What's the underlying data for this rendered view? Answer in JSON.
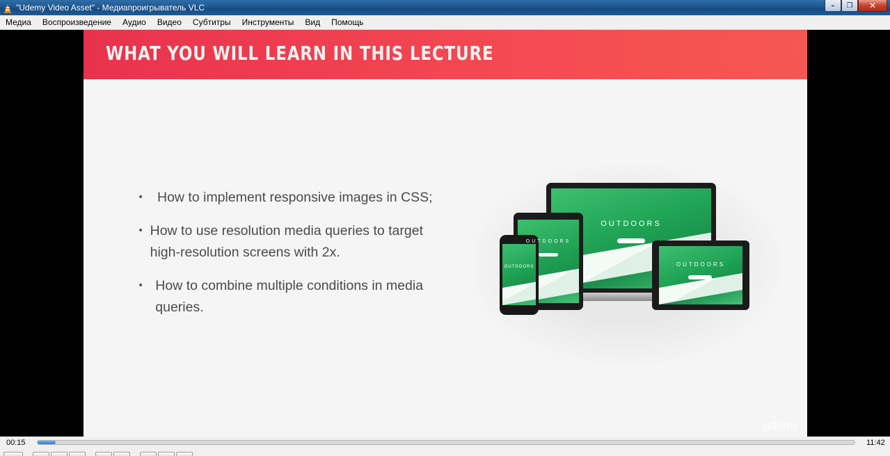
{
  "window": {
    "title": "\"Udemy Video Asset\" - Медиапроигрыватель VLC",
    "app_icon": "vlc-cone-icon",
    "buttons": {
      "minimize": "–",
      "maximize": "❐",
      "close": "✕"
    }
  },
  "menu": [
    {
      "label": "Медиа"
    },
    {
      "label": "Воспроизведение"
    },
    {
      "label": "Аудио"
    },
    {
      "label": "Видео"
    },
    {
      "label": "Субтитры"
    },
    {
      "label": "Инструменты"
    },
    {
      "label": "Вид"
    },
    {
      "label": "Помощь"
    }
  ],
  "slide": {
    "title": "WHAT YOU WILL LEARN IN THIS LECTURE",
    "bullets": [
      "How to implement responsive images in CSS;",
      "How to use resolution media queries to target high-resolution screens with 2x.",
      "How to combine multiple conditions in media queries."
    ],
    "device_text": "OUTDOORS",
    "watermark": "udemy",
    "colors": {
      "header_start": "#e8324d",
      "header_end": "#f65753",
      "device_green": "#1fa355"
    }
  },
  "player": {
    "elapsed": "00:15",
    "total": "11:42",
    "progress": 0.021
  }
}
